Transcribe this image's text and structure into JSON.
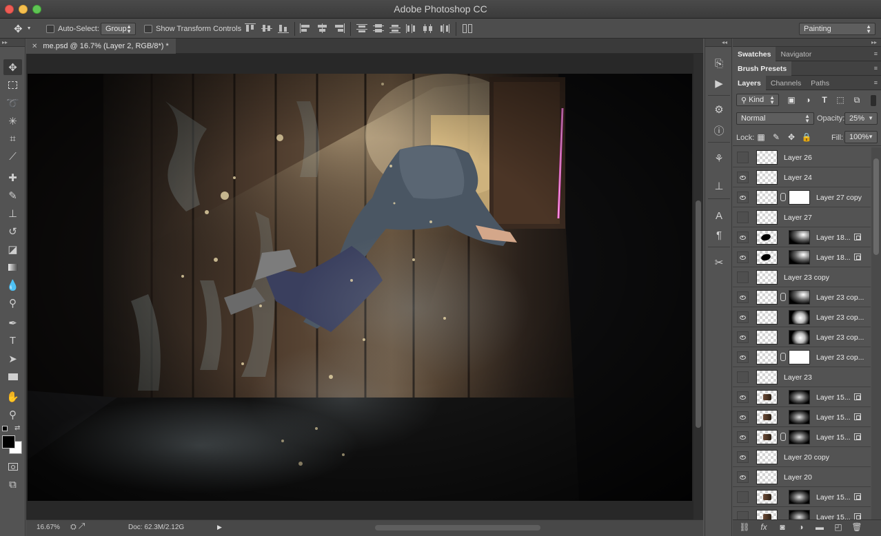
{
  "window": {
    "title": "Adobe Photoshop CC"
  },
  "options_bar": {
    "auto_select_label": "Auto-Select:",
    "auto_select_value": "Group",
    "transform_label": "Show Transform Controls",
    "workspace": "Painting"
  },
  "document": {
    "tab_title": "me.psd @ 16.7% (Layer 2, RGB/8*) *",
    "zoom": "16.67%",
    "doc_size": "Doc: 62.3M/2.12G"
  },
  "panels": {
    "group1": [
      "Swatches",
      "Navigator"
    ],
    "group2": [
      "Brush Presets"
    ],
    "group3": [
      "Layers",
      "Channels",
      "Paths"
    ],
    "filter_kind": "Kind",
    "blend_mode": "Normal",
    "opacity_label": "Opacity:",
    "opacity_value": "25%",
    "lock_label": "Lock:",
    "fill_label": "Fill:",
    "fill_value": "100%"
  },
  "layers": [
    {
      "name": "Layer 26",
      "visible": false,
      "mask": null,
      "chain": false,
      "smart": false
    },
    {
      "name": "Layer 24",
      "visible": true,
      "mask": null,
      "chain": false,
      "smart": false
    },
    {
      "name": "Layer 27 copy",
      "visible": true,
      "mask": "white-blobs",
      "chain": true,
      "smart": false
    },
    {
      "name": "Layer 27",
      "visible": false,
      "mask": null,
      "chain": false,
      "smart": false
    },
    {
      "name": "Layer 18...",
      "visible": true,
      "mask": "soft-beam",
      "chain": false,
      "smart": true,
      "dark_thumb": true
    },
    {
      "name": "Layer 18...",
      "visible": true,
      "mask": "soft-beam",
      "chain": false,
      "smart": true,
      "dark_thumb": true
    },
    {
      "name": "Layer 23 copy",
      "visible": false,
      "mask": null,
      "chain": false,
      "smart": false
    },
    {
      "name": "Layer 23 cop...",
      "visible": true,
      "mask": "soft-beam",
      "chain": true,
      "smart": false
    },
    {
      "name": "Layer 23 cop...",
      "visible": true,
      "mask": "glow",
      "chain": false,
      "smart": false
    },
    {
      "name": "Layer 23 cop...",
      "visible": true,
      "mask": "glow",
      "chain": false,
      "smart": false
    },
    {
      "name": "Layer 23 cop...",
      "visible": true,
      "mask": "white",
      "chain": true,
      "smart": false
    },
    {
      "name": "Layer 23",
      "visible": false,
      "mask": null,
      "chain": false,
      "smart": false
    },
    {
      "name": "Layer 15...",
      "visible": true,
      "mask": "smoke",
      "chain": false,
      "smart": true,
      "photo_thumb": true
    },
    {
      "name": "Layer 15...",
      "visible": true,
      "mask": "smoke",
      "chain": false,
      "smart": true,
      "photo_thumb": true
    },
    {
      "name": "Layer 15...",
      "visible": true,
      "mask": "smoke",
      "chain": true,
      "smart": true,
      "photo_thumb": true
    },
    {
      "name": "Layer 20 copy",
      "visible": true,
      "mask": null,
      "chain": false,
      "smart": false
    },
    {
      "name": "Layer 20",
      "visible": true,
      "mask": null,
      "chain": false,
      "smart": false
    },
    {
      "name": "Layer 15...",
      "visible": false,
      "mask": "smoke",
      "chain": false,
      "smart": true,
      "photo_thumb": true
    },
    {
      "name": "Layer 15...",
      "visible": false,
      "mask": "smoke",
      "chain": false,
      "smart": true,
      "photo_thumb": true
    }
  ],
  "colors": {
    "panel_bg": "#535353",
    "canvas_bg": "#282828",
    "accent_pink": "#ff4fd8"
  }
}
